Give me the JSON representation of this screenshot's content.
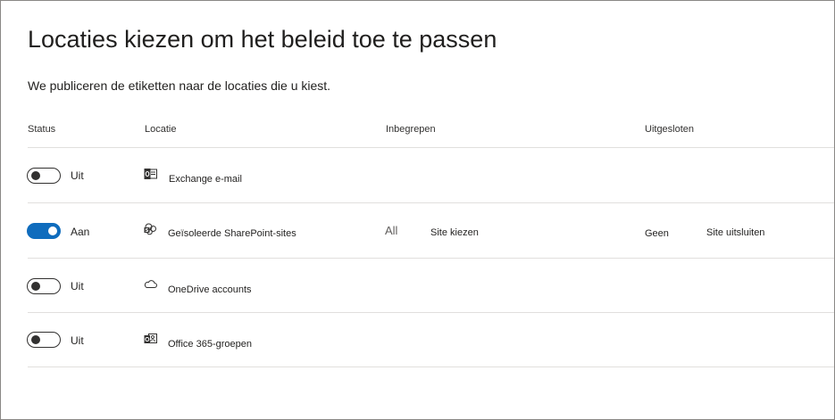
{
  "page": {
    "title": "Locaties kiezen om het beleid toe te passen",
    "subtitle": "We publiceren de etiketten naar de locaties die u kiest."
  },
  "columns": {
    "status": "Status",
    "location": "Locatie",
    "included": "Inbegrepen",
    "excluded": "Uitgesloten"
  },
  "rows": [
    {
      "toggle_state": "off",
      "status_label": "Uit",
      "icon": "exchange-outlook-icon",
      "location": "Exchange e-mail"
    },
    {
      "toggle_state": "on",
      "status_label": "Aan",
      "icon": "sharepoint-icon",
      "location": "Geïsoleerde SharePoint-sites",
      "included_value": "All",
      "included_action": "Site kiezen",
      "excluded_value": "Geen",
      "excluded_action": "Site uitsluiten"
    },
    {
      "toggle_state": "off",
      "status_label": "Uit",
      "icon": "onedrive-cloud-icon",
      "location": "OneDrive accounts"
    },
    {
      "toggle_state": "off",
      "status_label": "Uit",
      "icon": "office365-groups-icon",
      "location": "Office 365-groepen"
    }
  ],
  "colors": {
    "toggle_on": "#0f6cbd",
    "toggle_off_border": "#323130",
    "divider": "#e1dfdd",
    "frame_border": "#8a8886"
  }
}
